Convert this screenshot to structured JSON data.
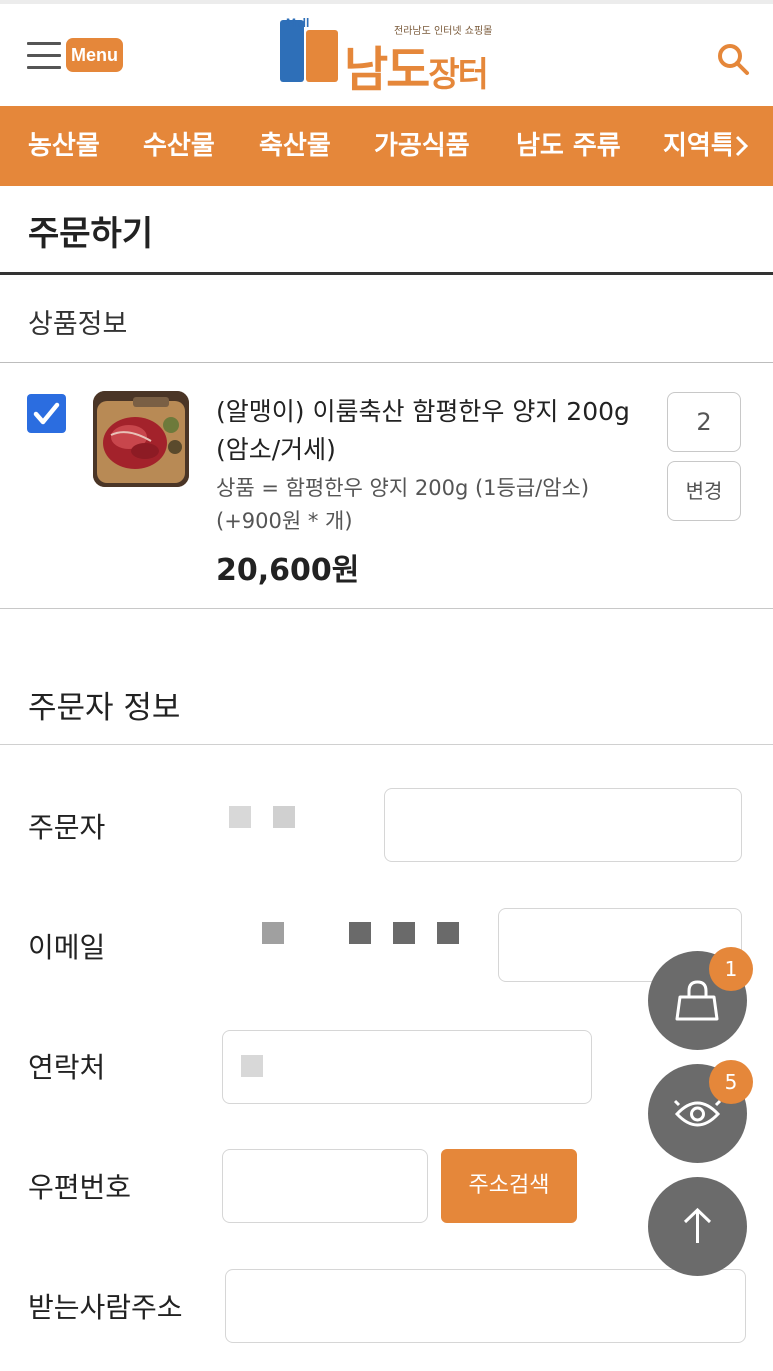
{
  "header": {
    "menu_label": "Menu",
    "logo_mall": "Mall",
    "logo_subtitle": "전라남도 인터넷 쇼핑몰",
    "logo_main_1": "남도",
    "logo_main_2": "장터"
  },
  "nav": {
    "items": [
      "농산물",
      "수산물",
      "축산물",
      "가공식품",
      "남도 주류",
      "지역특"
    ]
  },
  "page": {
    "title": "주문하기",
    "product_section": "상품정보",
    "orderer_section": "주문자 정보"
  },
  "product": {
    "name": "(알맹이) 이룸축산 함평한우 양지 200g (암소/거세)",
    "option": "상품 = 함평한우 양지 200g (1등급/암소) (+900원 * 개)",
    "price": "20,600원",
    "quantity": "2",
    "change_label": "변경",
    "checked": true
  },
  "form": {
    "orderer_label": "주문자",
    "email_label": "이메일",
    "phone_label": "연락처",
    "zipcode_label": "우편번호",
    "zip_search_label": "주소검색",
    "address_label": "받는사람주소"
  },
  "floating": {
    "cart_count": "1",
    "recent_count": "5"
  },
  "colors": {
    "brand_orange": "#e5873a",
    "brand_blue": "#2e6fb8",
    "checkbox_blue": "#2b6de0",
    "fab_gray": "#6b6b6b"
  }
}
